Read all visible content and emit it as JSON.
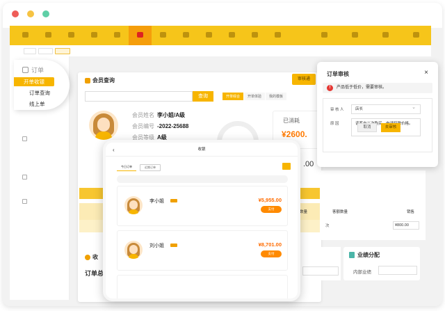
{
  "colors": {
    "accent": "#f7b500",
    "nav_bg": "#f6c51a",
    "amount": "#ff6b00",
    "close_dot": "#ee5d58",
    "min_dot": "#f6c343",
    "max_dot": "#5fcfa6"
  },
  "sidebar_popup": {
    "title": "订单",
    "items": [
      "开单收银",
      "订单查询",
      "线上单"
    ]
  },
  "member_card": {
    "title": "会员查询",
    "search_button": "查询",
    "review_button": "审核通",
    "tabs": [
      "开单综合",
      "开单体验",
      "我的模板"
    ],
    "name_label": "会员姓名",
    "name_value": "李小姐/A级",
    "id_label": "会员编号",
    "id_value": "-2022-25688",
    "level_label": "会员等级",
    "level_value": "A级",
    "spent_label": "已消耗",
    "spent_value": "¥2600.",
    "side_value": ".00",
    "col_heads": [
      "户理数量",
      "客额数量",
      "销售"
    ],
    "row_value": "次",
    "price_value": "¥800.00",
    "footer_left": "收",
    "footer_left2": "订单总"
  },
  "performance": {
    "title": "业绩分配",
    "label": "内部业绩"
  },
  "dialog": {
    "title": "订单审核",
    "close": "×",
    "warning": "产品低于低价，需要审核。",
    "auditor_label": "审 核 人",
    "auditor_value": "店长",
    "reason_label": "原    因",
    "reason_value": "该客户二次购买，申请特殊价格。",
    "cancel": "取消",
    "submit": "去审核"
  },
  "tablet": {
    "header": "收银",
    "tabs": [
      "今日订单",
      "近期订单"
    ],
    "orders": [
      {
        "name": "李小姐",
        "amount": "¥5,955.00",
        "button": "支付"
      },
      {
        "name": "刘小姐",
        "amount": "¥8,701.00",
        "button": "支付"
      }
    ]
  }
}
